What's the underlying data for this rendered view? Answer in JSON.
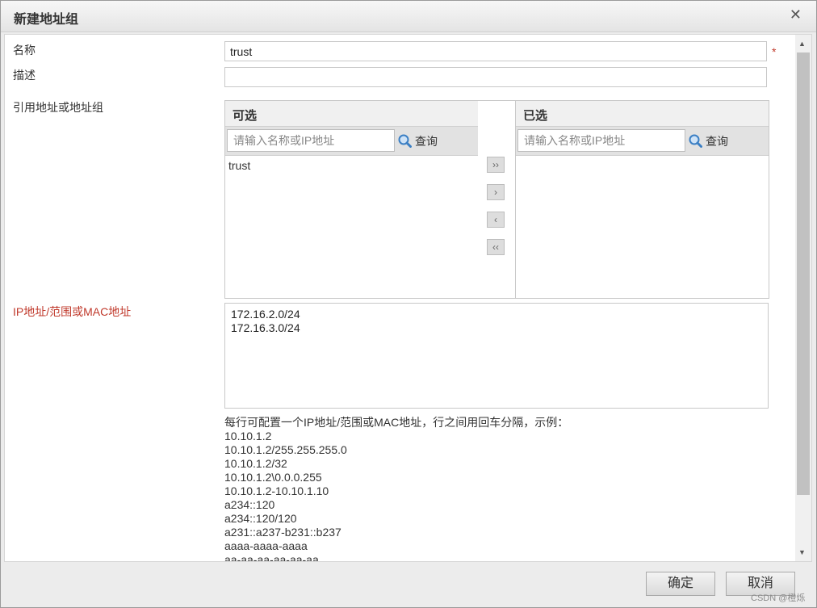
{
  "dialog": {
    "title": "新建地址组",
    "close_glyph": "✕"
  },
  "form": {
    "name_label": "名称",
    "name_value": "trust",
    "required_mark": "*",
    "desc_label": "描述",
    "desc_value": "",
    "ref_label": "引用地址或地址组",
    "ip_label": "IP地址/范围或MAC地址"
  },
  "available": {
    "header": "可选",
    "search_placeholder": "请输入名称或IP地址",
    "query_label": "查询",
    "items": [
      "trust"
    ]
  },
  "selected": {
    "header": "已选",
    "search_placeholder": "请输入名称或IP地址",
    "query_label": "查询",
    "items": []
  },
  "transfer_buttons": {
    "add_all": "››",
    "add": "›",
    "remove": "‹",
    "remove_all": "‹‹"
  },
  "ip_entries": [
    "172.16.2.0/24",
    "172.16.3.0/24"
  ],
  "help": {
    "intro": "每行可配置一个IP地址/范围或MAC地址，行之间用回车分隔，示例：",
    "examples": [
      "10.10.1.2",
      "10.10.1.2/255.255.255.0",
      "10.10.1.2/32",
      "10.10.1.2\\0.0.0.255",
      "10.10.1.2-10.10.1.10",
      "a234::120",
      "a234::120/120",
      "a231::a237-b231::b237",
      "aaaa-aaaa-aaaa",
      "aa-aa-aa-aa-aa-aa"
    ]
  },
  "footer": {
    "ok_label": "确定",
    "cancel_label": "取消"
  },
  "watermark": "CSDN @橙烁"
}
